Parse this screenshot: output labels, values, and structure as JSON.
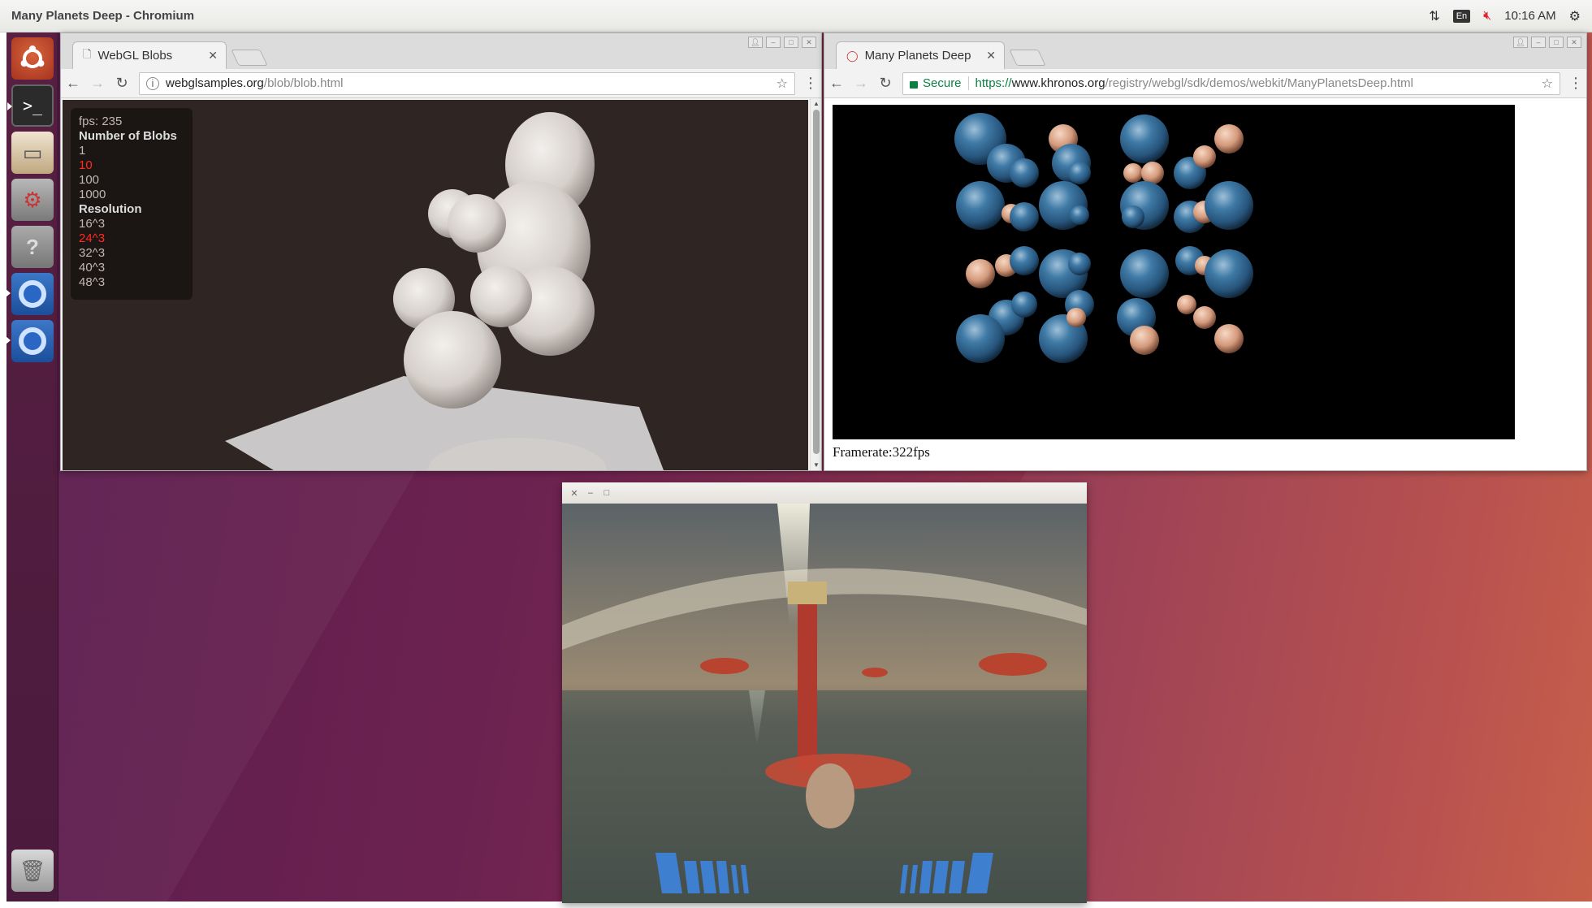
{
  "topbar": {
    "title": "Many Planets Deep - Chromium",
    "keyboard_layout": "En",
    "clock": "10:16 AM",
    "icons": [
      "network-arrows-icon",
      "keyboard-layout-icon",
      "volume-muted-icon",
      "power-gear-icon"
    ]
  },
  "launcher": {
    "items": [
      {
        "name": "ubuntu-dash",
        "icon": "ubuntu-logo-icon"
      },
      {
        "name": "terminal",
        "icon": "terminal-icon",
        "label": ">_"
      },
      {
        "name": "files",
        "icon": "file-cabinet-icon"
      },
      {
        "name": "system-settings",
        "icon": "settings-gear-icon"
      },
      {
        "name": "help",
        "icon": "help-icon",
        "label": "?"
      },
      {
        "name": "chromium-1",
        "icon": "chromium-icon"
      },
      {
        "name": "chromium-2",
        "icon": "chromium-icon"
      },
      {
        "name": "trash",
        "icon": "trash-icon"
      }
    ]
  },
  "browser_left": {
    "tab_title": "WebGL Blobs",
    "url_host": "webglsamples.org",
    "url_path": "/blob/blob.html",
    "panel": {
      "fps": "fps: 235",
      "blobs_heading": "Number of Blobs",
      "blob_options": [
        "1",
        "10",
        "100",
        "1000"
      ],
      "blob_selected": "10",
      "resolution_heading": "Resolution",
      "resolution_options": [
        "16^3",
        "24^3",
        "32^3",
        "40^3",
        "48^3"
      ],
      "resolution_selected": "24^3"
    }
  },
  "browser_right": {
    "tab_title": "Many Planets Deep",
    "secure_label": "Secure",
    "url_scheme": "https://",
    "url_host": "www.khronos.org",
    "url_path": "/registry/webgl/sdk/demos/webkit/ManyPlanetsDeep.html",
    "framerate": "Framerate:322fps"
  },
  "colors": {
    "selected_option": "#ff2b1f",
    "secure_green": "#0b8043",
    "desktop_left": "#5a1c4e",
    "desktop_right": "#c45740"
  }
}
